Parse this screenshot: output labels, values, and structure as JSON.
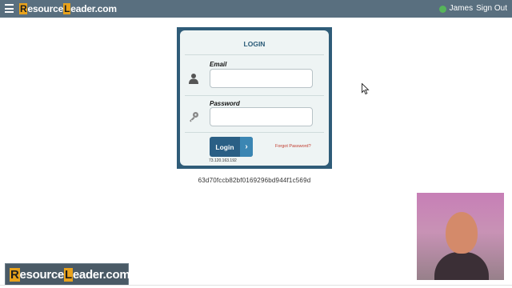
{
  "topbar": {
    "brand_cap1": "R",
    "brand_part1": "esource",
    "brand_cap2": "L",
    "brand_part2": "eader.com",
    "user_name": "James",
    "sign_out_label": "Sign Out"
  },
  "login": {
    "title": "LOGIN",
    "email_label": "Email",
    "email_value": "",
    "password_label": "Password",
    "password_value": "",
    "button_label": "Login",
    "button_arrow": "›",
    "forgot_label": "Forgot Password?",
    "ip_address": "73.120.163.192"
  },
  "hash_text": "63d70fccb82bf0169296bd944f1c569d",
  "badge": {
    "cap1": "R",
    "part1": "esource",
    "cap2": "L",
    "part2": "eader.com"
  },
  "colors": {
    "topbar": "#596f7f",
    "accent": "#e8a21c",
    "login_frame": "#2f5c78",
    "login_button": "#2a5f85",
    "forgot_link": "#c0392b"
  },
  "icons": {
    "menu": "hamburger-menu-icon",
    "user_status": "user-online-icon",
    "email_field": "person-icon",
    "password_field": "key-icon",
    "cursor": "mouse-pointer-icon"
  }
}
